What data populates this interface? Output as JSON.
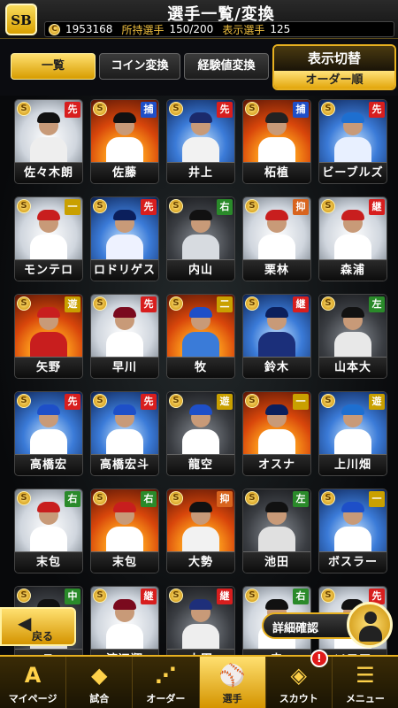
{
  "header": {
    "logo": "SB",
    "title": "選手一覧/変換",
    "coin_icon": "coin-icon",
    "coins": "1953168",
    "owned_label": "所持選手",
    "owned_value": "150/200",
    "display_label": "表示選手",
    "display_value": "125"
  },
  "tabs": [
    {
      "label": "一覧",
      "active": true
    },
    {
      "label": "コイン変換",
      "active": false
    },
    {
      "label": "経験値変換",
      "active": false
    }
  ],
  "display_toggle": {
    "title": "表示切替",
    "mode": "オーダー順"
  },
  "cards": [
    {
      "name": "佐々木朗",
      "pos": "先",
      "pos_color": "#d81e1e",
      "art": "art-white",
      "cap": "#111111",
      "uniform": "#eeeeee"
    },
    {
      "name": "佐藤",
      "pos": "捕",
      "pos_color": "#1f4fc8",
      "art": "art-fire",
      "cap": "#111111",
      "uniform": "#ffffff"
    },
    {
      "name": "井上",
      "pos": "先",
      "pos_color": "#d81e1e",
      "art": "art-blue",
      "cap": "#1b2a6b",
      "uniform": "#f2f2f2"
    },
    {
      "name": "柘植",
      "pos": "捕",
      "pos_color": "#1f4fc8",
      "art": "art-fire",
      "cap": "#222222",
      "uniform": "#ffffff"
    },
    {
      "name": "ビーブルズ",
      "pos": "先",
      "pos_color": "#d81e1e",
      "art": "art-blue",
      "cap": "#1e6fd0",
      "uniform": "#e8f0ff"
    },
    {
      "name": "モンテロ",
      "pos": "一",
      "pos_color": "#c9a000",
      "art": "art-white",
      "cap": "#c81e1e",
      "uniform": "#ffffff"
    },
    {
      "name": "ロドリゲス",
      "pos": "先",
      "pos_color": "#d81e1e",
      "art": "art-blue",
      "cap": "#0b1f5c",
      "uniform": "#eef2ff"
    },
    {
      "name": "内山",
      "pos": "右",
      "pos_color": "#2a8a2a",
      "art": "art-dark",
      "cap": "#111111",
      "uniform": "#d7dbe0"
    },
    {
      "name": "栗林",
      "pos": "抑",
      "pos_color": "#d8641e",
      "art": "art-white",
      "cap": "#c81e1e",
      "uniform": "#ffffff"
    },
    {
      "name": "森浦",
      "pos": "継",
      "pos_color": "#d81e1e",
      "art": "art-white",
      "cap": "#c81e1e",
      "uniform": "#ffffff"
    },
    {
      "name": "矢野",
      "pos": "遊",
      "pos_color": "#c9a000",
      "art": "art-fire",
      "cap": "#c81e1e",
      "uniform": "#c81e1e"
    },
    {
      "name": "早川",
      "pos": "先",
      "pos_color": "#d81e1e",
      "art": "art-white",
      "cap": "#7a0a1e",
      "uniform": "#ffffff"
    },
    {
      "name": "牧",
      "pos": "二",
      "pos_color": "#c9a000",
      "art": "art-fire",
      "cap": "#1e4fc8",
      "uniform": "#3a7bd8"
    },
    {
      "name": "鈴木",
      "pos": "継",
      "pos_color": "#d81e1e",
      "art": "art-blue",
      "cap": "#0b1f5c",
      "uniform": "#1b2f7a"
    },
    {
      "name": "山本大",
      "pos": "左",
      "pos_color": "#2a8a2a",
      "art": "art-dark",
      "cap": "#111111",
      "uniform": "#e8e8e8"
    },
    {
      "name": "高橋宏",
      "pos": "先",
      "pos_color": "#d81e1e",
      "art": "art-blue",
      "cap": "#1e4fc8",
      "uniform": "#ffffff"
    },
    {
      "name": "高橋宏斗",
      "pos": "先",
      "pos_color": "#d81e1e",
      "art": "art-blue",
      "cap": "#1e4fc8",
      "uniform": "#ffffff"
    },
    {
      "name": "龍空",
      "pos": "遊",
      "pos_color": "#c9a000",
      "art": "art-dark",
      "cap": "#1e4fc8",
      "uniform": "#ffffff"
    },
    {
      "name": "オスナ",
      "pos": "一",
      "pos_color": "#c9a000",
      "art": "art-fire",
      "cap": "#0b1f5c",
      "uniform": "#ffffff"
    },
    {
      "name": "上川畑",
      "pos": "遊",
      "pos_color": "#c9a000",
      "art": "art-blue",
      "cap": "#1e6fd0",
      "uniform": "#ffffff"
    },
    {
      "name": "末包",
      "pos": "右",
      "pos_color": "#2a8a2a",
      "art": "art-white",
      "cap": "#c81e1e",
      "uniform": "#ffffff"
    },
    {
      "name": "末包",
      "pos": "右",
      "pos_color": "#2a8a2a",
      "art": "art-fire",
      "cap": "#c81e1e",
      "uniform": "#ffffff"
    },
    {
      "name": "大勢",
      "pos": "抑",
      "pos_color": "#d8641e",
      "art": "art-fire",
      "cap": "#111111",
      "uniform": "#f2f2f2"
    },
    {
      "name": "池田",
      "pos": "左",
      "pos_color": "#2a8a2a",
      "art": "art-dark",
      "cap": "#111111",
      "uniform": "#e0e0e0"
    },
    {
      "name": "ボスラー",
      "pos": "一",
      "pos_color": "#c9a000",
      "art": "art-blue",
      "cap": "#1e4fc8",
      "uniform": "#ffffff"
    },
    {
      "name": "ス",
      "pos": "中",
      "pos_color": "#2a8a2a",
      "art": "art-dark",
      "cap": "#111111",
      "uniform": "#dddddd"
    },
    {
      "name": "渡辺翔",
      "pos": "継",
      "pos_color": "#d81e1e",
      "art": "art-white",
      "cap": "#7a0a1e",
      "uniform": "#ffffff"
    },
    {
      "name": "山田",
      "pos": "継",
      "pos_color": "#d81e1e",
      "art": "art-dark",
      "cap": "#1e2f7a",
      "uniform": "#eeeeee"
    },
    {
      "name": "森",
      "pos": "右",
      "pos_color": "#2a8a2a",
      "art": "art-white",
      "cap": "#111111",
      "uniform": "#ffffff"
    },
    {
      "name": "ソフア",
      "pos": "先",
      "pos_color": "#d81e1e",
      "art": "art-white",
      "cap": "#111111",
      "uniform": "#ffffff"
    }
  ],
  "back_button": {
    "label": "戻る"
  },
  "detail_button": {
    "label": "詳細確認"
  },
  "nav": [
    {
      "label": "マイページ",
      "icon": "A",
      "icon_name": "mypage-icon",
      "active": false
    },
    {
      "label": "試合",
      "icon": "◆",
      "icon_name": "stadium-icon",
      "active": false
    },
    {
      "label": "オーダー",
      "icon": "⋰",
      "icon_name": "order-icon",
      "active": false
    },
    {
      "label": "選手",
      "icon": "⚾",
      "icon_name": "player-icon",
      "active": true
    },
    {
      "label": "スカウト",
      "icon": "◈",
      "icon_name": "scout-icon",
      "active": false,
      "alert": "!"
    },
    {
      "label": "メニュー",
      "icon": "☰",
      "icon_name": "menu-icon",
      "active": false
    }
  ]
}
